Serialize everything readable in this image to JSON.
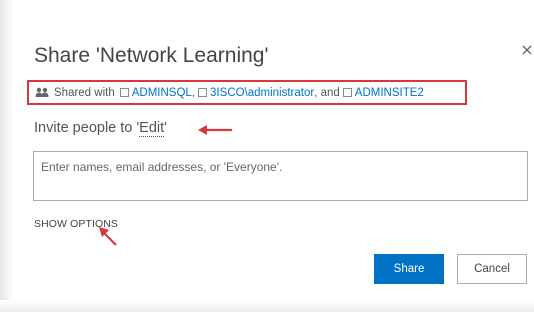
{
  "dialog": {
    "title": "Share 'Network Learning'",
    "close_icon": "close-icon"
  },
  "shared_with": {
    "icon": "people-icon",
    "prefix": "Shared with",
    "people": [
      {
        "name": "ADMINSQL",
        "suffix": ","
      },
      {
        "name": "3ISCO\\administrator",
        "suffix": ", and"
      },
      {
        "name": "ADMINSITE2",
        "suffix": ""
      }
    ],
    "highlight_color": "#d9363e"
  },
  "invite": {
    "prefix": "Invite people to",
    "permission_quote_open": "'",
    "permission": "Edit",
    "permission_quote_close": "'"
  },
  "people_input": {
    "placeholder": "Enter names, email addresses, or 'Everyone'.",
    "value": ""
  },
  "show_options_label": "SHOW OPTIONS",
  "buttons": {
    "share": "Share",
    "cancel": "Cancel"
  },
  "colors": {
    "accent": "#0072c6",
    "annotation": "#d9363e"
  }
}
